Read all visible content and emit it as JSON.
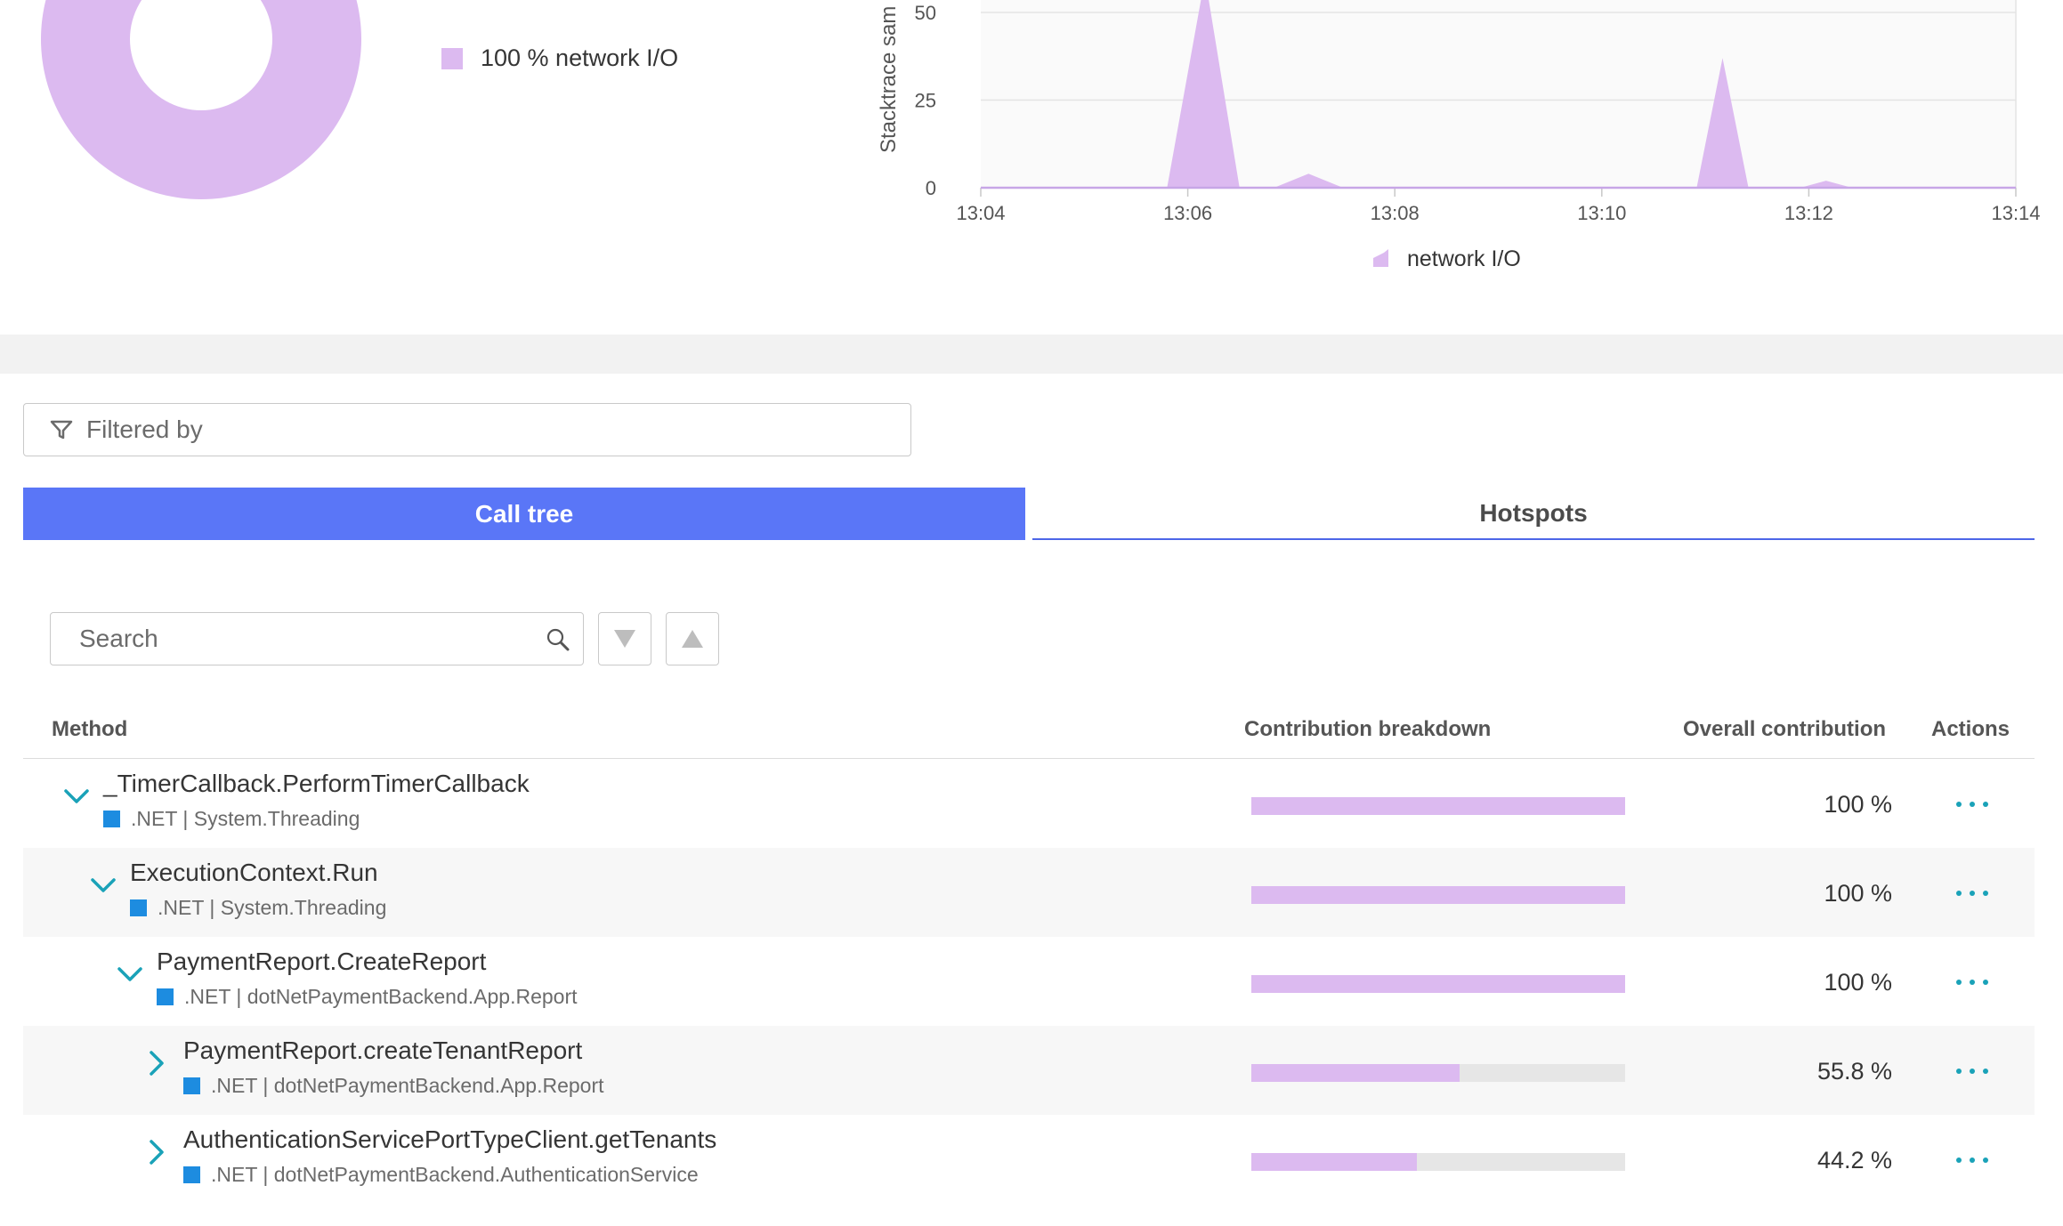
{
  "donut": {
    "legend_label": "100 % network I/O",
    "color": "#dcbaf0"
  },
  "chart_data": {
    "type": "area",
    "ylabel": "Stacktrace sam",
    "xlabel": "",
    "x_ticks": [
      "13:04",
      "13:06",
      "13:08",
      "13:10",
      "13:12",
      "13:14"
    ],
    "y_ticks": [
      "0",
      "25",
      "50"
    ],
    "ylim": [
      0,
      50
    ],
    "grid": true,
    "legend": "bottom-center",
    "series": [
      {
        "name": "network I/O",
        "color": "#dcbaf0",
        "points": [
          [
            "13:04",
            0
          ],
          [
            "13:05:48",
            0
          ],
          [
            "13:06:10",
            60
          ],
          [
            "13:06:30",
            0
          ],
          [
            "13:06:50",
            0
          ],
          [
            "13:07:10",
            4
          ],
          [
            "13:07:30",
            0
          ],
          [
            "13:10:55",
            0
          ],
          [
            "13:11:10",
            37
          ],
          [
            "13:11:25",
            0
          ],
          [
            "13:11:55",
            0
          ],
          [
            "13:12:10",
            2
          ],
          [
            "13:12:25",
            0
          ],
          [
            "13:14",
            0
          ]
        ]
      }
    ]
  },
  "filter": {
    "label": "Filtered by"
  },
  "tabs": {
    "call_tree": "Call tree",
    "hotspots": "Hotspots"
  },
  "search": {
    "placeholder": "Search"
  },
  "table": {
    "headers": {
      "method": "Method",
      "contribution": "Contribution breakdown",
      "overall": "Overall contribution",
      "actions": "Actions"
    },
    "rows": [
      {
        "name": "_TimerCallback.PerformTimerCallback",
        "sub": ".NET | System.Threading",
        "pct": "100 %",
        "value": 100,
        "expanded": true
      },
      {
        "name": "ExecutionContext.Run",
        "sub": ".NET | System.Threading",
        "pct": "100 %",
        "value": 100,
        "expanded": true
      },
      {
        "name": "PaymentReport.CreateReport",
        "sub": ".NET | dotNetPaymentBackend.App.Report",
        "pct": "100 %",
        "value": 100,
        "expanded": true
      },
      {
        "name": "PaymentReport.createTenantReport",
        "sub": ".NET | dotNetPaymentBackend.App.Report",
        "pct": "55.8 %",
        "value": 55.8,
        "expanded": false
      },
      {
        "name": "AuthenticationServicePortTypeClient.getTenants",
        "sub": ".NET | dotNetPaymentBackend.AuthenticationService",
        "pct": "44.2 %",
        "value": 44.2,
        "expanded": false
      }
    ]
  },
  "colors": {
    "accent": "#5a76f7",
    "bar": "#dcbaf0",
    "tech": "#1d8ce0",
    "chevron": "#1aa2b8"
  }
}
